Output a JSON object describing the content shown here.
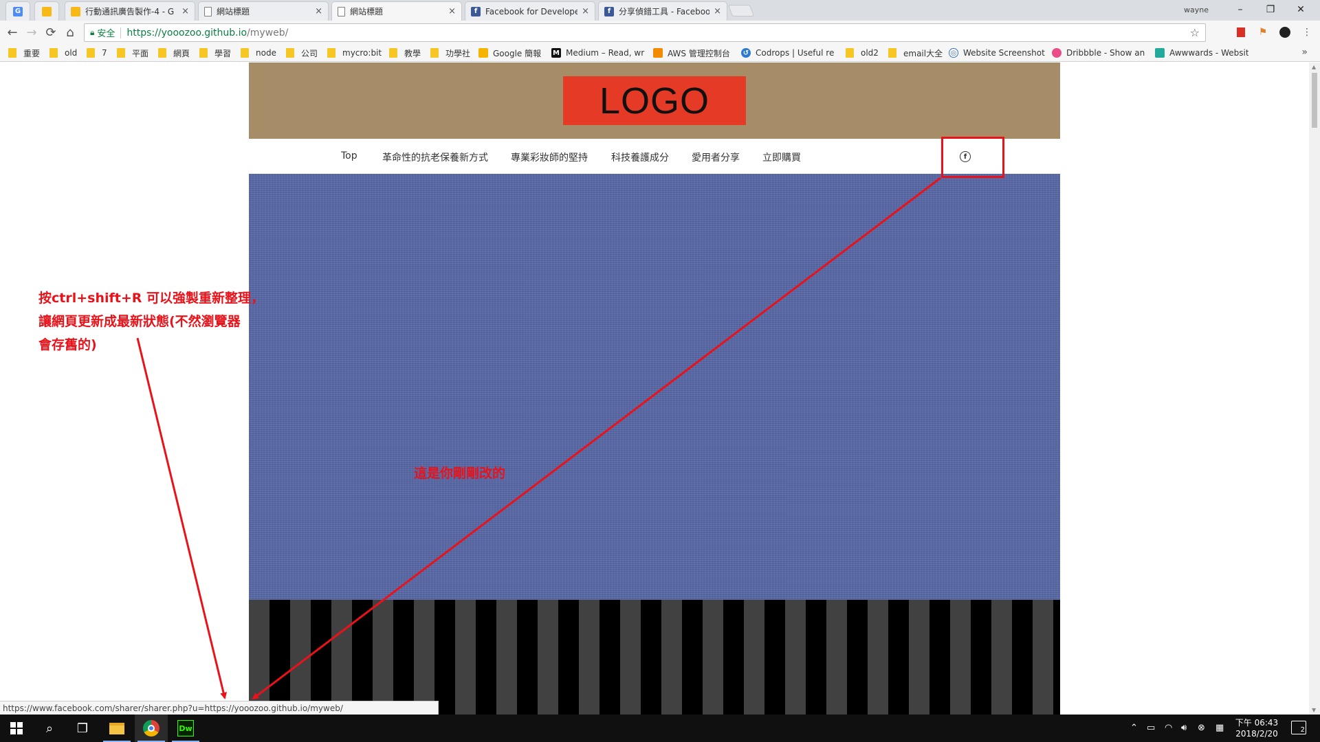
{
  "browser": {
    "tabs": [
      {
        "title": "",
        "icon": "google-translate-icon",
        "pinned": true
      },
      {
        "title": "",
        "icon": "google-slides-icon",
        "pinned": true
      },
      {
        "title": "行動通訊廣告製作-4 - G",
        "icon": "google-slides-icon"
      },
      {
        "title": "網站標題",
        "icon": "page-icon"
      },
      {
        "title": "網站標題",
        "icon": "page-icon",
        "active": true
      },
      {
        "title": "Facebook for Develope",
        "icon": "facebook-icon"
      },
      {
        "title": "分享偵錯工具 - Faceboo",
        "icon": "facebook-icon"
      }
    ],
    "close_glyph": "×",
    "profile_name": "wayne",
    "window_controls": {
      "minimize": "–",
      "restore": "❐",
      "close": "✕"
    },
    "security_label": "安全",
    "url_host": "https://yooozoo.github.io",
    "url_path": "/myweb/",
    "bookmarks": [
      {
        "label": "重要",
        "icon": "folder-icon"
      },
      {
        "label": "old",
        "icon": "folder-icon"
      },
      {
        "label": "7",
        "icon": "folder-icon"
      },
      {
        "label": "平面",
        "icon": "folder-icon"
      },
      {
        "label": "網頁",
        "icon": "folder-icon"
      },
      {
        "label": "學習",
        "icon": "folder-icon"
      },
      {
        "label": "node",
        "icon": "folder-icon"
      },
      {
        "label": "公司",
        "icon": "folder-icon"
      },
      {
        "label": "mycro:bit",
        "icon": "folder-icon"
      },
      {
        "label": "教學",
        "icon": "folder-icon"
      },
      {
        "label": "功學社",
        "icon": "folder-icon"
      },
      {
        "label": "Google 簡報",
        "icon": "google-slides-icon"
      },
      {
        "label": "Medium – Read, wri",
        "icon": "medium-icon"
      },
      {
        "label": "AWS 管理控制台",
        "icon": "aws-icon"
      },
      {
        "label": "Codrops | Useful res",
        "icon": "codrops-icon"
      },
      {
        "label": "old2",
        "icon": "folder-icon"
      },
      {
        "label": "email大全",
        "icon": "folder-icon"
      },
      {
        "label": "Website Screenshot",
        "icon": "globe-icon"
      },
      {
        "label": "Dribbble - Show and",
        "icon": "dribbble-icon"
      },
      {
        "label": "Awwwards - Websit",
        "icon": "awwwards-icon"
      }
    ],
    "bookmarks_more": "»",
    "status_url": "https://www.facebook.com/sharer/sharer.php?u=https://yooozoo.github.io/myweb/"
  },
  "site": {
    "logo_text": "LOGO",
    "nav": [
      "Top",
      "革命性的抗老保養新方式",
      "專業彩妝師的堅持",
      "科技養護成分",
      "愛用者分享",
      "立即購買"
    ],
    "social_icon": "facebook-circle-icon",
    "colors": {
      "header": "#a68d67",
      "logo": "#e53a26",
      "hero": "#5867a5",
      "stripe_dark": "#414141",
      "stripe_black": "#000000"
    }
  },
  "annotations": {
    "note_lines": [
      "按ctrl+shift+R 可以強製重新整理，",
      "讓網頁更新成最新狀態(不然瀏覽器",
      "會存舊的)"
    ],
    "changed_label": "這是你剛剛改的",
    "color": "#e8131a"
  },
  "taskbar": {
    "apps": [
      "start-icon",
      "search-icon",
      "task-view-icon",
      "file-explorer-icon",
      "chrome-icon",
      "dreamweaver-icon"
    ],
    "dw_label": "Dw",
    "clock_time": "下午 06:43",
    "clock_date": "2018/2/20",
    "notification_count": "2"
  }
}
